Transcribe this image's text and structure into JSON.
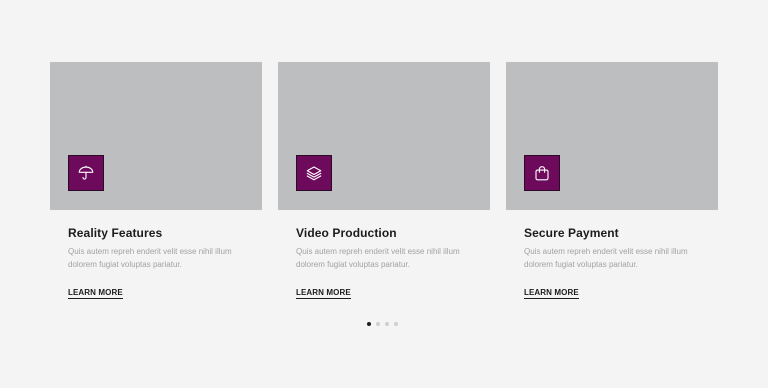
{
  "cards": [
    {
      "title": "Reality Features",
      "description": "Quis autem repreh enderit velit esse nihil illum dolorem fugiat voluptas pariatur.",
      "link_label": "LEARN MORE",
      "icon": "umbrella-icon"
    },
    {
      "title": "Video Production",
      "description": "Quis autem repreh enderit velit esse nihil illum dolorem fugiat voluptas pariatur.",
      "link_label": "LEARN MORE",
      "icon": "layers-icon"
    },
    {
      "title": "Secure Payment",
      "description": "Quis autem repreh enderit velit esse nihil illum dolorem fugiat voluptas pariatur.",
      "link_label": "LEARN MORE",
      "icon": "shopping-bag-icon"
    }
  ],
  "pagination": {
    "total": 4,
    "active_index": 0
  },
  "colors": {
    "icon_background": "#6e0a5c",
    "image_placeholder": "#bdbebf",
    "page_background": "#f4f4f4"
  }
}
